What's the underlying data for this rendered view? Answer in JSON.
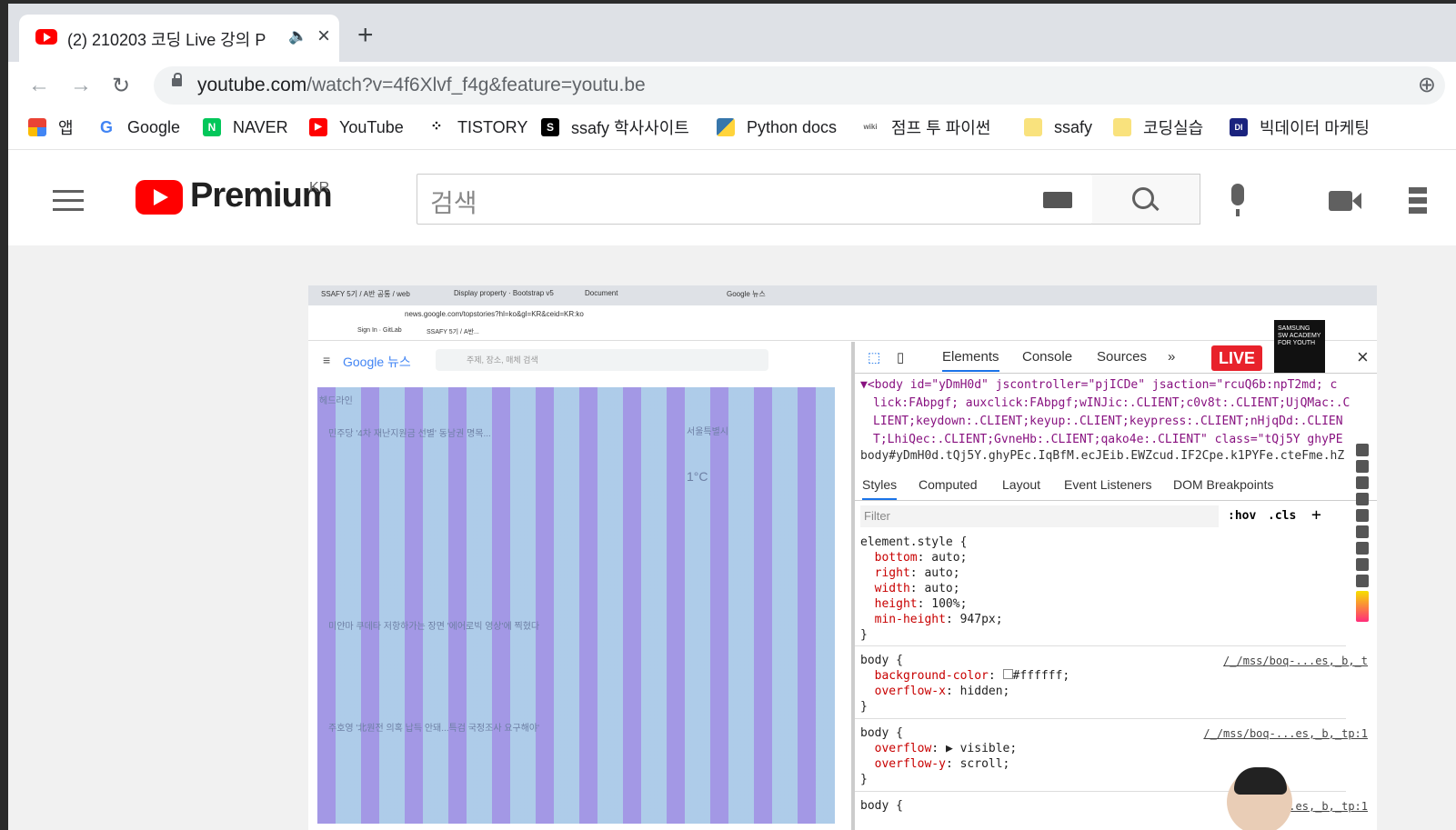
{
  "browser": {
    "tab": {
      "title": "(2) 210203 코딩 Live 강의 P",
      "audio_icon": "speaker-icon"
    },
    "url": {
      "domain": "youtube.com",
      "path": "/watch?v=4f6Xlvf_f4g&feature=youtu.be"
    },
    "bookmarks": [
      {
        "label": "앱"
      },
      {
        "label": "Google"
      },
      {
        "label": "NAVER"
      },
      {
        "label": "YouTube"
      },
      {
        "label": "TISTORY"
      },
      {
        "label": "ssafy 학사사이트"
      },
      {
        "label": "Python docs"
      },
      {
        "label": "점프 투 파이썬"
      },
      {
        "label": "ssafy"
      },
      {
        "label": "코딩실습"
      },
      {
        "label": "빅데이터 마케팅"
      }
    ]
  },
  "youtube": {
    "logo_text": "Premium",
    "country": "KR",
    "search_placeholder": "검색"
  },
  "video": {
    "inner_tabs": [
      "SSAFY 5기 / A반 공통 / web",
      "Display property · Bootstrap v5",
      "Document",
      "Google 뉴스"
    ],
    "inner_url": "news.google.com/topstories?hl=ko&gl=KR&ceid=KR:ko",
    "inner_bookmarks": [
      "Sign In · GitLab",
      "SSAFY 5기 / A반..."
    ],
    "gnews": {
      "logo": "Google 뉴스",
      "search": "주제, 장소, 매체 검색",
      "section": "헤드라인",
      "headlines": [
        "민주당 '4차 재난지원금 선별' 동남권 명목...",
        "미얀마 쿠데타 저항하가는 장면 '에어로빅 영상'에 찍혔다",
        "주호영 '北원전 의혹 납득 안돼...특검 국정조사 요구해야'"
      ],
      "weather_label": "서울특별시",
      "weather_temp": "1°C"
    },
    "devtools": {
      "tabs": [
        "Elements",
        "Console",
        "Sources"
      ],
      "live_badge": "LIVE",
      "dom_lines": [
        "▼<body id=\"yDmH0d\" jscontroller=\"pjICDe\" jsaction=\"rcuQ6b:npT2md; c",
        "lick:FAbpgf; auxclick:FAbpgf;wINJic:.CLIENT;c0v8t:.CLIENT;UjQMac:.C",
        "LIENT;keydown:.CLIENT;keyup:.CLIENT;keypress:.CLIENT;nHjqDd:.CLIEN",
        "T;LhiQec:.CLIENT;GvneHb:.CLIENT;qako4e:.CLIENT\" class=\"tQj5Y ghyPE"
      ],
      "breadcrumb": "body#yDmH0d.tQj5Y.ghyPEc.IqBfM.ecJEib.EWZcud.IF2Cpe.k1PYFe.cteFme.hZ",
      "style_tabs": [
        "Styles",
        "Computed",
        "Layout",
        "Event Listeners",
        "DOM Breakpoints"
      ],
      "filter_placeholder": "Filter",
      "hov": ":hov",
      "cls": ".cls",
      "rules": [
        {
          "selector": "element.style {",
          "decls": [
            [
              "bottom",
              "auto;"
            ],
            [
              "right",
              "auto;"
            ],
            [
              "width",
              "auto;"
            ],
            [
              "height",
              "100%;"
            ],
            [
              "min-height",
              "947px;"
            ]
          ],
          "source": ""
        },
        {
          "selector": "body {",
          "decls": [
            [
              "background-color",
              "#ffffff;"
            ],
            [
              "overflow-x",
              "hidden;"
            ]
          ],
          "source": "/_/mss/boq-...es,_b,_t"
        },
        {
          "selector": "body {",
          "decls": [
            [
              "overflow",
              "▶ visible;"
            ],
            [
              "overflow-y",
              "scroll;"
            ]
          ],
          "source": "/_/mss/boq-...es,_b,_tp:1"
        },
        {
          "selector": "body {",
          "decls": [],
          "source": "/_/m...es,_b,_tp:1"
        }
      ]
    },
    "samsung_badge": "SAMSUNG SW ACADEMY FOR YOUTH"
  }
}
